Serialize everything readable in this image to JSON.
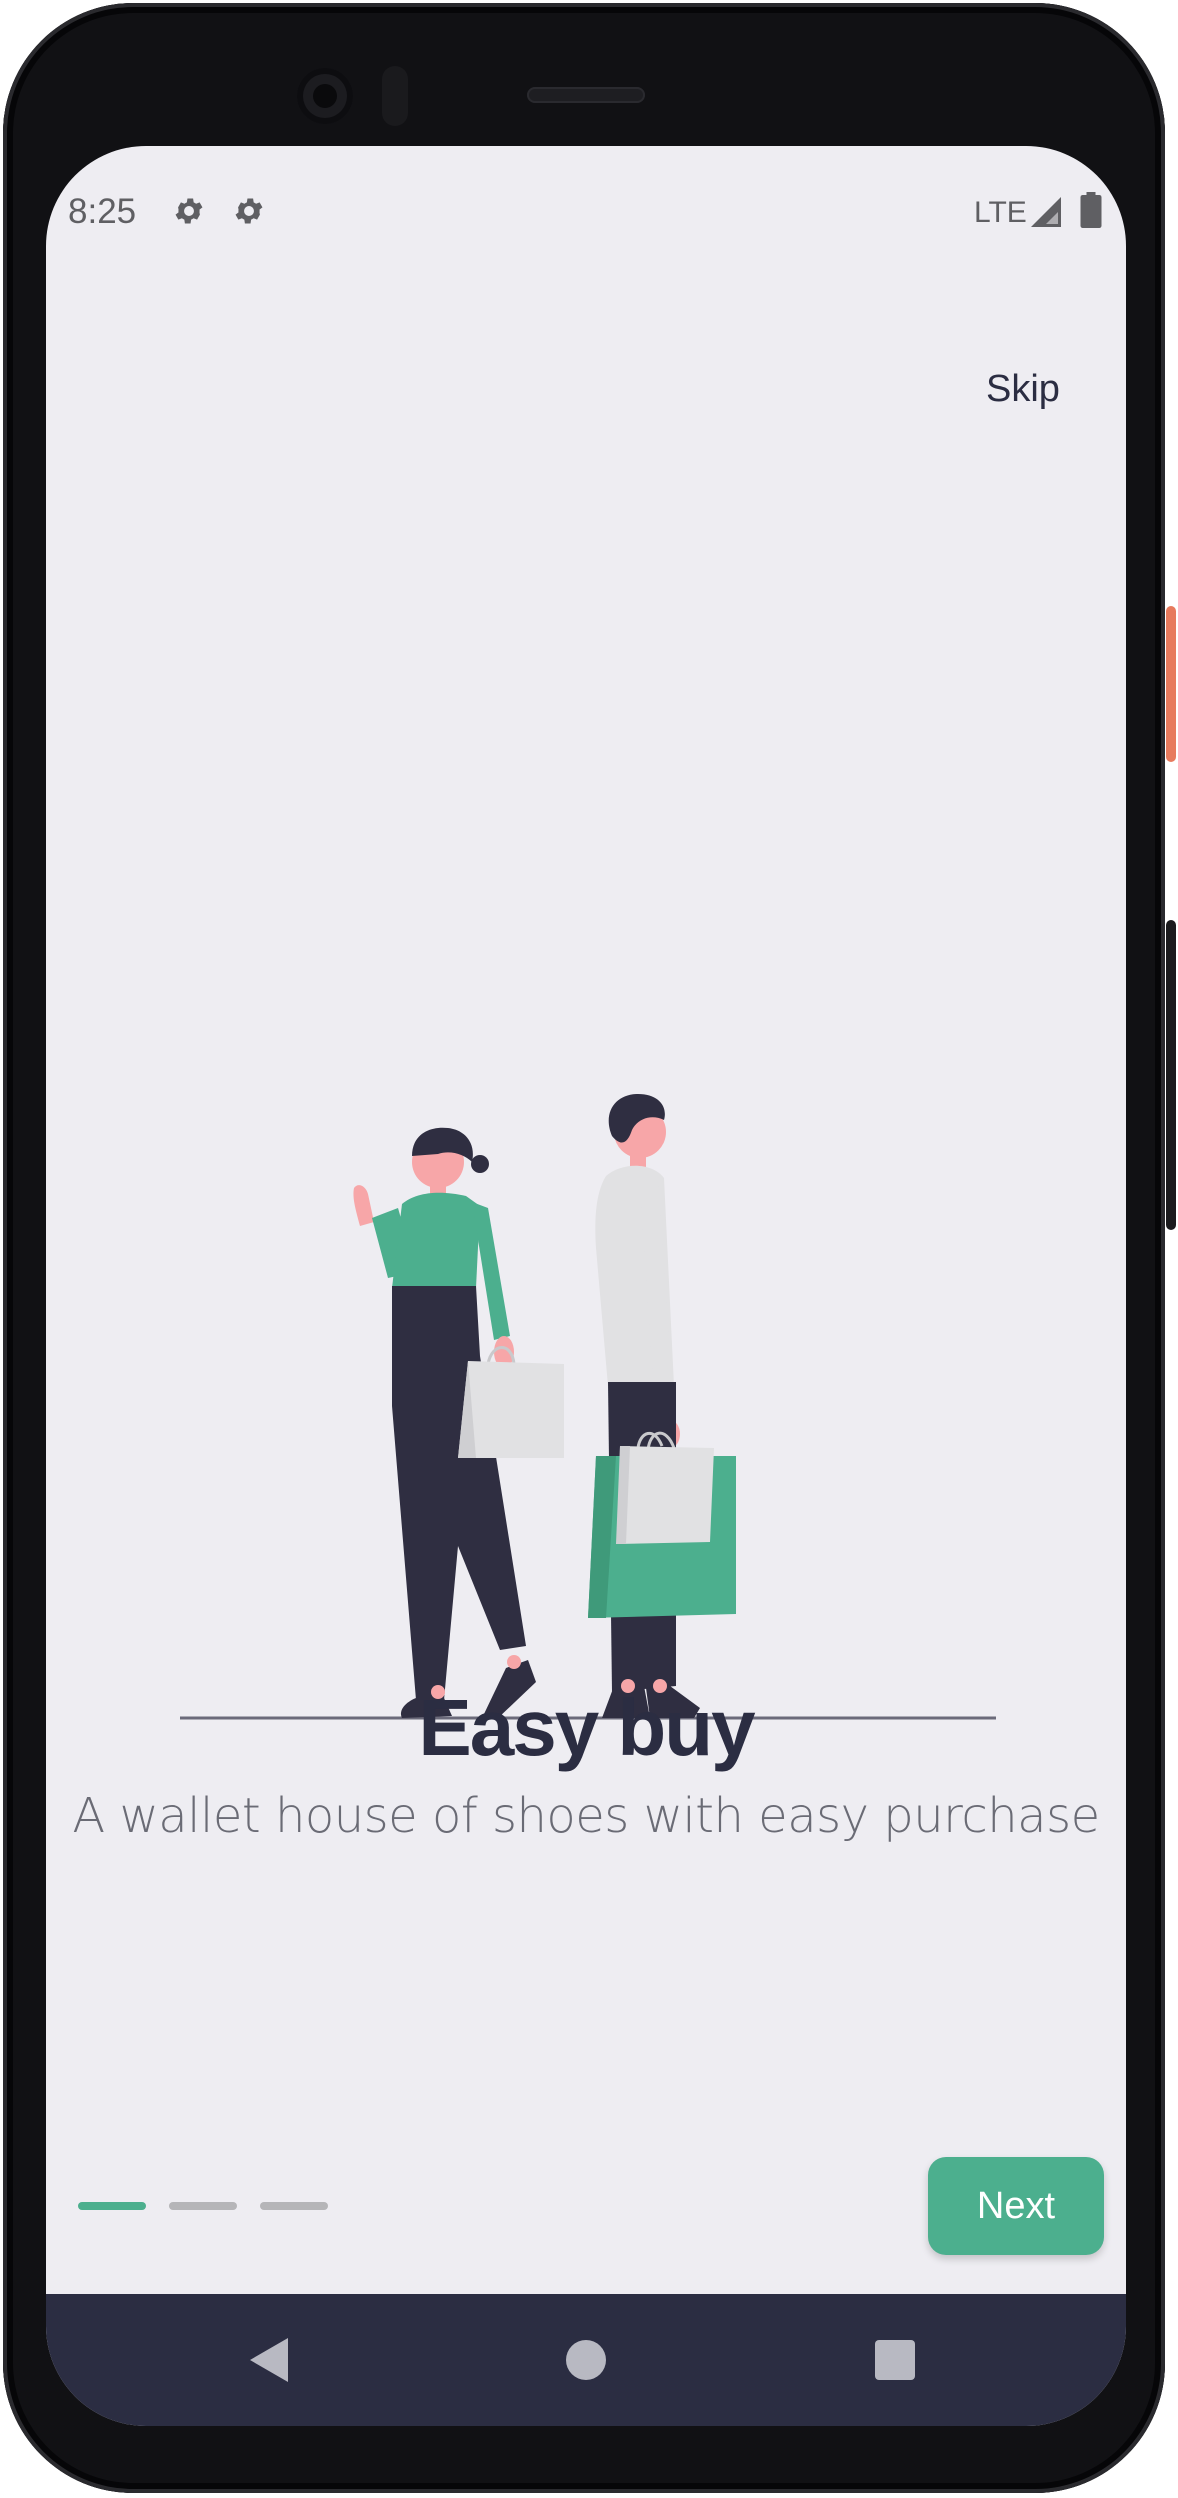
{
  "status_bar": {
    "time": "8:25",
    "network": "LTE",
    "icons": [
      "gear-icon",
      "gear-icon",
      "signal-icon",
      "battery-icon"
    ]
  },
  "onboarding": {
    "skip_label": "Skip",
    "title": "Easy buy",
    "subtitle": "A wallet house of shoes with easy purchase",
    "next_label": "Next",
    "pages_total": 3,
    "current_page": 1
  },
  "nav_bar": {
    "icons": [
      "back-icon",
      "home-icon",
      "recents-icon"
    ]
  },
  "colors": {
    "accent": "#4caf8e",
    "dark": "#2b2d42",
    "background": "#eeedf2",
    "inactive_indicator": "#b5b5b8",
    "power_button": "#e77a5d"
  }
}
